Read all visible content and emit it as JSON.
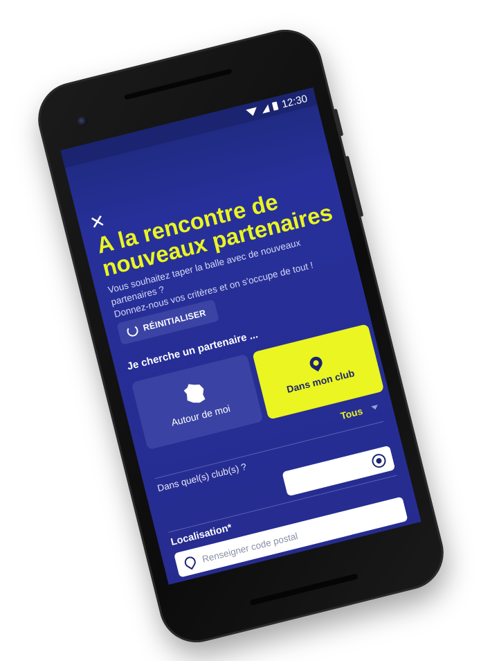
{
  "status_bar": {
    "time": "12:30",
    "icons": [
      "wifi-icon",
      "signal-icon",
      "battery-icon"
    ]
  },
  "header": {
    "close_icon": "close-icon",
    "close_glyph": "✕",
    "title_line1": "A la rencontre de",
    "title_line2": "nouveaux partenaires",
    "subtitle_line1": "Vous souhaitez taper la balle avec de nouveaux",
    "subtitle_line2": "partenaires ?",
    "subtitle_line3": "Donnez-nous vos critères et on s'occupe de tout !"
  },
  "reset": {
    "label": "RÉINITIALISER",
    "icon": "reset-icon"
  },
  "search": {
    "section_label": "Je cherche un partenaire ...",
    "options": [
      {
        "label": "Autour de moi",
        "icon": "france-map-icon",
        "selected": false
      },
      {
        "label": "Dans mon club",
        "icon": "location-pin-icon",
        "selected": true
      }
    ],
    "club_filter_value": "Tous",
    "clubs_question": "Dans quel(s) club(s) ?"
  },
  "location": {
    "label": "Localisation*",
    "placeholder": "Renseigner code postal",
    "locate_icon": "target-icon",
    "input_icon": "location-pin-outline-icon"
  },
  "colors": {
    "screen_bg": "#262c8f",
    "accent_yellow": "#eaf521",
    "card_bg": "#3a43a3",
    "text_white": "#ffffff"
  }
}
